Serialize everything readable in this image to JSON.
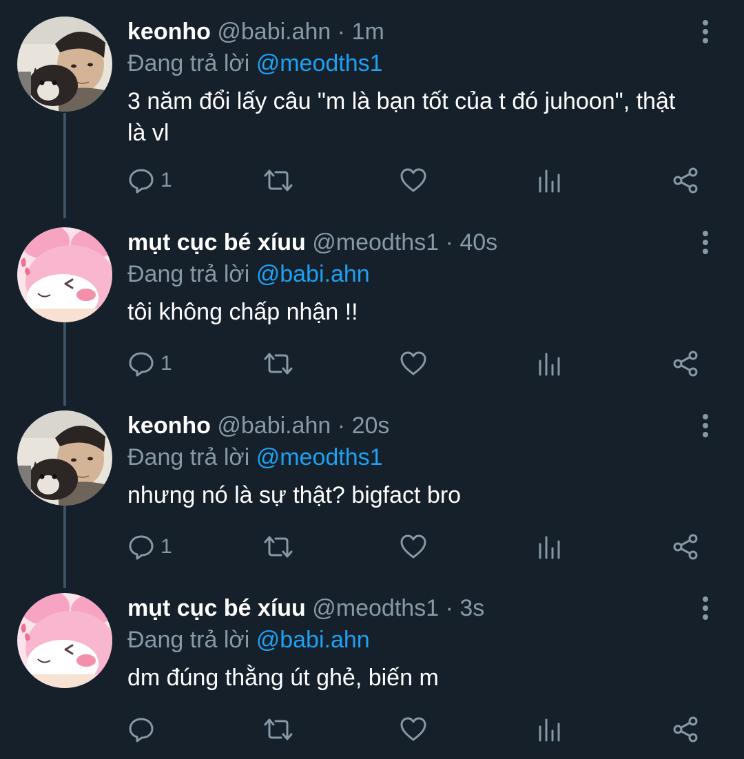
{
  "colors": {
    "background": "#15202b",
    "name": "#ffffff",
    "secondary": "#8899a6",
    "mention": "#1da1f2",
    "thread_line": "#3d5466"
  },
  "replying_label": "Đang trả lời",
  "tweets": [
    {
      "name": "keonho",
      "handle": "@babi.ahn",
      "time": "· 1m",
      "replying_to": "@meodths1",
      "text_line1": "3 năm đổi lấy câu \"m là bạn tốt của t đó juhoon\", thật",
      "text_line2": "là vl",
      "reply_count": "1",
      "avatar": "boy-with-dog-photo"
    },
    {
      "name": "mụt cục bé xíuu",
      "handle": "@meodths1",
      "time": "· 40s",
      "replying_to": "@babi.ahn",
      "text_line1": "tôi không chấp nhận !!",
      "text_line2": "",
      "reply_count": "1",
      "avatar": "pink-bunny-character"
    },
    {
      "name": "keonho",
      "handle": "@babi.ahn",
      "time": "· 20s",
      "replying_to": "@meodths1",
      "text_line1": "nhưng nó là sự thật? bigfact bro",
      "text_line2": "",
      "reply_count": "1",
      "avatar": "boy-with-dog-photo"
    },
    {
      "name": "mụt cục bé xíuu",
      "handle": "@meodths1",
      "time": "· 3s",
      "replying_to": "@babi.ahn",
      "text_line1": "dm đúng thằng út ghẻ, biến m",
      "text_line2": "",
      "reply_count": "",
      "avatar": "pink-bunny-character"
    }
  ],
  "icons": {
    "reply": "reply-icon",
    "retweet": "retweet-icon",
    "like": "heart-icon",
    "analytics": "analytics-icon",
    "share": "share-icon",
    "more": "more-vertical-icon"
  }
}
